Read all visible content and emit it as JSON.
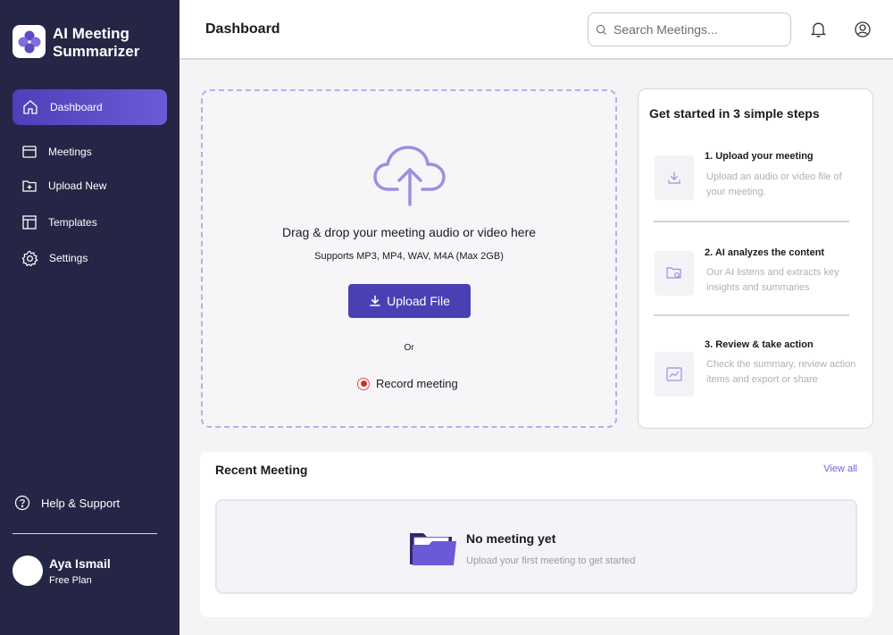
{
  "app": {
    "title": "AI Meeting Summarizer"
  },
  "sidebar": {
    "items": [
      {
        "label": "Dashboard",
        "icon": "home-icon",
        "active": true
      },
      {
        "label": "Meetings",
        "icon": "calendar-icon"
      },
      {
        "label": "Upload  New",
        "icon": "folder-plus-icon"
      },
      {
        "label": "Templates",
        "icon": "layout-grid-icon"
      },
      {
        "label": "Settings",
        "icon": "gear-icon"
      }
    ],
    "help_label": "Help & Support"
  },
  "user": {
    "name": "Aya Ismail",
    "plan": "Free Plan"
  },
  "header": {
    "title": "Dashboard",
    "search_placeholder": "Search Meetings..."
  },
  "upload": {
    "drop_text": "Drag & drop your meeting audio or video here",
    "formats": "Supports MP3, MP4, WAV, M4A (Max 2GB)",
    "button_label": "Upload File",
    "or_text": "Or",
    "record_label": "Record meeting"
  },
  "steps": {
    "title": "Get started in 3 simple steps",
    "items": [
      {
        "title": "1. Upload your meeting",
        "desc": "Upload  an audio or video file of your meeting.",
        "icon": "download-icon"
      },
      {
        "title": "2. AI analyzes the content",
        "desc": "Our AI listens and extracts key insights and summaries",
        "icon": "folder-search-icon"
      },
      {
        "title": "3. Review & take action",
        "desc": "Check the summary, review action items and export or share",
        "icon": "chart-line-icon"
      }
    ]
  },
  "recent": {
    "title": "Recent Meeting",
    "view_all": "View all",
    "empty_title": "No meeting yet",
    "empty_desc": "Upload your first meeting to get started"
  },
  "colors": {
    "sidebar_bg": "#252646",
    "accent": "#4b40b3",
    "accent_light": "#9d8fe0",
    "record_red": "#d62b2b"
  }
}
